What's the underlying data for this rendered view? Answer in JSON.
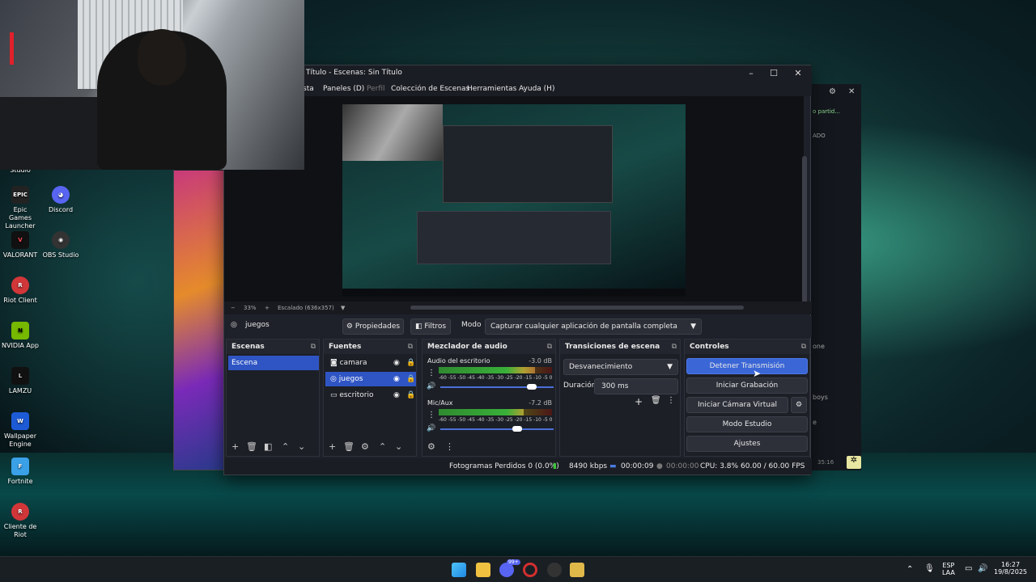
{
  "desktop_icons": [
    {
      "label": "Studio",
      "icon": "obs-studio-icon"
    },
    {
      "label": "Epic Games Launcher",
      "icon": "epic-games-icon"
    },
    {
      "label": "Discord",
      "icon": "discord-icon"
    },
    {
      "label": "VALORANT",
      "icon": "valorant-icon"
    },
    {
      "label": "OBS Studio",
      "icon": "obs-icon"
    },
    {
      "label": "Riot Client",
      "icon": "riot-icon"
    },
    {
      "label": "NVIDIA App",
      "icon": "nvidia-icon"
    },
    {
      "label": "LAMZU",
      "icon": "lamzu-icon"
    },
    {
      "label": "Wallpaper Engine",
      "icon": "wallpaper-engine-icon"
    },
    {
      "label": "Fortnite",
      "icon": "fortnite-icon"
    },
    {
      "label": "Cliente de Riot",
      "icon": "riot-icon"
    }
  ],
  "obs": {
    "title": "Título - Escenas: Sin Título",
    "menu": [
      "sta",
      "Paneles (D)",
      "Perfil",
      "Colección de Escenas",
      "Herramientas",
      "Ayuda (H)"
    ],
    "zoom": "33%",
    "scale": "Escalado (636x357)",
    "selected_source": "juegos",
    "properties_label": "Propiedades",
    "filters_label": "Filtros",
    "mode_label": "Modo",
    "mode_value": "Capturar cualquier aplicación de pantalla completa",
    "scenes": {
      "title": "Escenas",
      "items": [
        "Escena"
      ]
    },
    "sources": {
      "title": "Fuentes",
      "items": [
        "camara",
        "juegos",
        "escritorio"
      ]
    },
    "mixer": {
      "title": "Mezclador de audio",
      "channels": [
        {
          "name": "Audio del escritorio",
          "db": "-3.0 dB",
          "level": 0.85,
          "volume": 0.88
        },
        {
          "name": "Mic/Aux",
          "db": "-7.2 dB",
          "level": 0.75,
          "volume": 0.72
        }
      ],
      "ticks": "-60 -55 -50 -45 -40 -35 -30 -25 -20 -15 -10 -5 0"
    },
    "transitions": {
      "title": "Transiciones de escena",
      "type": "Desvanecimiento",
      "duration_label": "Duración",
      "duration": "300 ms"
    },
    "controls": {
      "title": "Controles",
      "buttons": [
        "Detener Transmisión",
        "Iniciar Grabación",
        "Iniciar Cámara Virtual",
        "Modo Estudio",
        "Ajustes"
      ]
    },
    "status": {
      "dropped": "Fotogramas Perdidos 0 (0.0%)",
      "bitrate": "8490 kbps",
      "live_time": "00:00:09",
      "rec_time": "00:00:00",
      "cpu": "CPU: 3.8%",
      "fps": "60.00 / 60.00 FPS"
    }
  },
  "back_window": {
    "notice": "o partid...",
    "label1": "ADO",
    "label2": "one",
    "label3": "boys",
    "label4": "e",
    "time": "35:16"
  },
  "taskbar": {
    "lang": "ESP",
    "lang2": "LAA",
    "time": "16:27",
    "date": "19/8/2025",
    "badge": "99+"
  },
  "colors": {
    "accent": "#2f55c4",
    "meter_green": "#39b039",
    "meter_red": "#a83232"
  }
}
